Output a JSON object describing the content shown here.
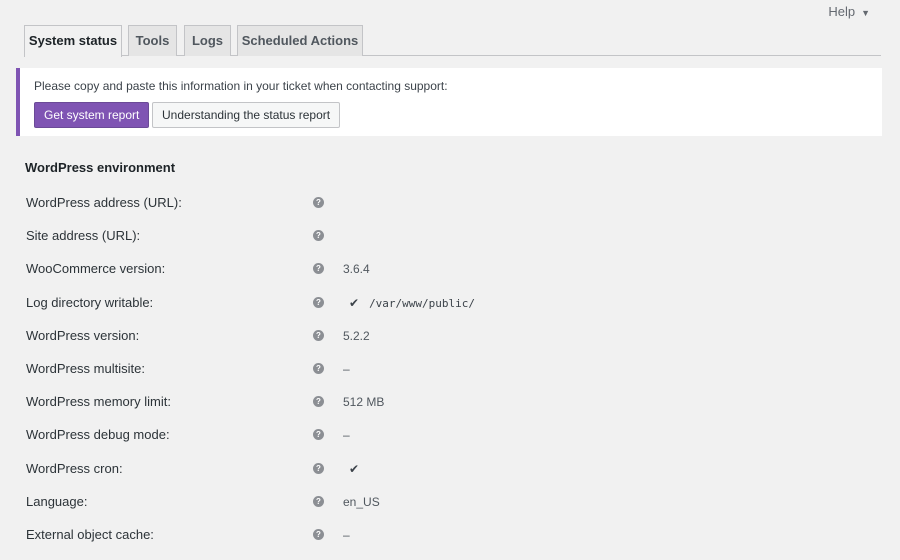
{
  "help": {
    "label": "Help"
  },
  "tabs": [
    {
      "label": "System status",
      "active": true
    },
    {
      "label": "Tools",
      "active": false
    },
    {
      "label": "Logs",
      "active": false
    },
    {
      "label": "Scheduled Actions",
      "active": false
    }
  ],
  "notice": {
    "text": "Please copy and paste this information in your ticket when contacting support:",
    "primary_button": "Get system report",
    "secondary_button": "Understanding the status report"
  },
  "section": {
    "title": "WordPress environment"
  },
  "rows": [
    {
      "label": "WordPress address (URL):",
      "value": ""
    },
    {
      "label": "Site address (URL):",
      "value": ""
    },
    {
      "label": "WooCommerce version:",
      "value": "3.6.4"
    },
    {
      "label": "Log directory writable:",
      "check": "✔",
      "value": "/var/www/public/"
    },
    {
      "label": "WordPress version:",
      "value": "5.2.2"
    },
    {
      "label": "WordPress multisite:",
      "value": "–"
    },
    {
      "label": "WordPress memory limit:",
      "value": "512 MB"
    },
    {
      "label": "WordPress debug mode:",
      "value": "–"
    },
    {
      "label": "WordPress cron:",
      "check": "✔",
      "value": ""
    },
    {
      "label": "Language:",
      "value": "en_US"
    },
    {
      "label": "External object cache:",
      "value": "–"
    }
  ],
  "colors": {
    "accent": "#7f54b3",
    "background": "#f1f1f1"
  }
}
